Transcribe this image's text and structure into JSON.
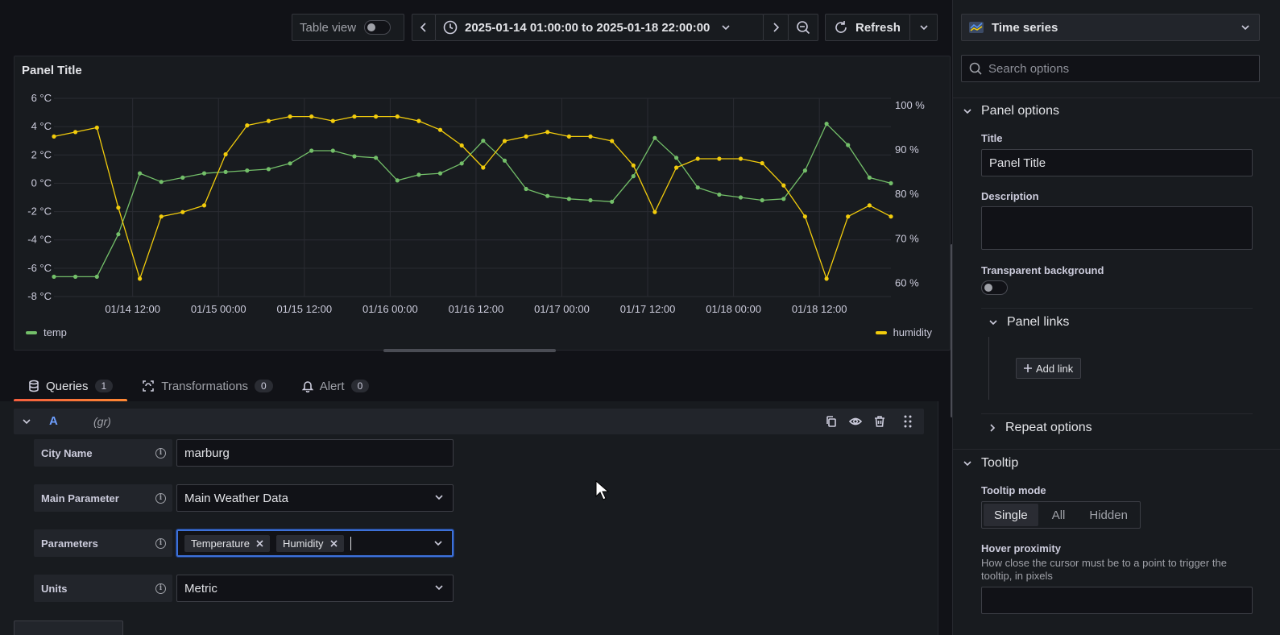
{
  "toolbar": {
    "table_view_label": "Table view",
    "time_range": "2025-01-14 01:00:00 to 2025-01-18 22:00:00",
    "refresh_label": "Refresh"
  },
  "panel": {
    "title": "Panel Title"
  },
  "chart_data": {
    "type": "line",
    "title": "Panel Title",
    "x_ticks": [
      "01/14 12:00",
      "01/15 00:00",
      "01/15 12:00",
      "01/16 00:00",
      "01/16 12:00",
      "01/17 00:00",
      "01/17 12:00",
      "01/18 00:00",
      "01/18 12:00"
    ],
    "y_left_ticks": [
      "6 °C",
      "4 °C",
      "2 °C",
      "0 °C",
      "-2 °C",
      "-4 °C",
      "-6 °C",
      "-8 °C"
    ],
    "y_right_ticks": [
      "100 %",
      "90 %",
      "80 %",
      "70 %",
      "60 %"
    ],
    "y_left_range": [
      -8,
      6
    ],
    "y_right_range": [
      57.0,
      101.6
    ],
    "x_range": [
      "2025-01-14 01:00",
      "2025-01-18 22:00"
    ],
    "grid": true,
    "legend": [
      "bottom-left",
      "bottom-right"
    ],
    "series": [
      {
        "name": "temp",
        "axis": "left",
        "color": "#73bf69",
        "points": [
          [
            "2025-01-14 01:00",
            -6.6
          ],
          [
            "2025-01-14 04:00",
            -6.6
          ],
          [
            "2025-01-14 07:00",
            -6.6
          ],
          [
            "2025-01-14 10:00",
            -3.6
          ],
          [
            "2025-01-14 13:00",
            0.7
          ],
          [
            "2025-01-14 16:00",
            0.1
          ],
          [
            "2025-01-14 19:00",
            0.4
          ],
          [
            "2025-01-14 22:00",
            0.7
          ],
          [
            "2025-01-15 01:00",
            0.8
          ],
          [
            "2025-01-15 04:00",
            0.9
          ],
          [
            "2025-01-15 07:00",
            1.0
          ],
          [
            "2025-01-15 10:00",
            1.4
          ],
          [
            "2025-01-15 13:00",
            2.3
          ],
          [
            "2025-01-15 16:00",
            2.3
          ],
          [
            "2025-01-15 19:00",
            1.9
          ],
          [
            "2025-01-15 22:00",
            1.8
          ],
          [
            "2025-01-16 01:00",
            0.2
          ],
          [
            "2025-01-16 04:00",
            0.6
          ],
          [
            "2025-01-16 07:00",
            0.7
          ],
          [
            "2025-01-16 10:00",
            1.4
          ],
          [
            "2025-01-16 13:00",
            3.0
          ],
          [
            "2025-01-16 16:00",
            1.6
          ],
          [
            "2025-01-16 19:00",
            -0.4
          ],
          [
            "2025-01-16 22:00",
            -0.9
          ],
          [
            "2025-01-17 01:00",
            -1.1
          ],
          [
            "2025-01-17 04:00",
            -1.2
          ],
          [
            "2025-01-17 07:00",
            -1.3
          ],
          [
            "2025-01-17 10:00",
            0.5
          ],
          [
            "2025-01-17 13:00",
            3.2
          ],
          [
            "2025-01-17 16:00",
            1.8
          ],
          [
            "2025-01-17 19:00",
            -0.3
          ],
          [
            "2025-01-17 22:00",
            -0.8
          ],
          [
            "2025-01-18 01:00",
            -1.0
          ],
          [
            "2025-01-18 04:00",
            -1.2
          ],
          [
            "2025-01-18 07:00",
            -1.1
          ],
          [
            "2025-01-18 10:00",
            0.9
          ],
          [
            "2025-01-18 13:00",
            4.2
          ],
          [
            "2025-01-18 16:00",
            2.7
          ],
          [
            "2025-01-18 19:00",
            0.4
          ],
          [
            "2025-01-18 22:00",
            0.0
          ]
        ]
      },
      {
        "name": "humidity",
        "axis": "right",
        "color": "#f2cc0c",
        "points": [
          [
            "2025-01-14 01:00",
            93
          ],
          [
            "2025-01-14 04:00",
            94
          ],
          [
            "2025-01-14 07:00",
            95
          ],
          [
            "2025-01-14 10:00",
            77
          ],
          [
            "2025-01-14 13:00",
            61
          ],
          [
            "2025-01-14 16:00",
            75
          ],
          [
            "2025-01-14 19:00",
            76
          ],
          [
            "2025-01-14 22:00",
            77.5
          ],
          [
            "2025-01-15 01:00",
            89
          ],
          [
            "2025-01-15 04:00",
            95.5
          ],
          [
            "2025-01-15 07:00",
            96.5
          ],
          [
            "2025-01-15 10:00",
            97.5
          ],
          [
            "2025-01-15 13:00",
            97.5
          ],
          [
            "2025-01-15 16:00",
            96.5
          ],
          [
            "2025-01-15 19:00",
            97.5
          ],
          [
            "2025-01-15 22:00",
            97.5
          ],
          [
            "2025-01-16 01:00",
            97.5
          ],
          [
            "2025-01-16 04:00",
            96.5
          ],
          [
            "2025-01-16 07:00",
            94.5
          ],
          [
            "2025-01-16 10:00",
            91
          ],
          [
            "2025-01-16 13:00",
            86
          ],
          [
            "2025-01-16 16:00",
            92
          ],
          [
            "2025-01-16 19:00",
            93
          ],
          [
            "2025-01-16 22:00",
            94
          ],
          [
            "2025-01-17 01:00",
            93
          ],
          [
            "2025-01-17 04:00",
            93
          ],
          [
            "2025-01-17 07:00",
            92
          ],
          [
            "2025-01-17 10:00",
            86.5
          ],
          [
            "2025-01-17 13:00",
            76
          ],
          [
            "2025-01-17 16:00",
            86
          ],
          [
            "2025-01-17 19:00",
            88
          ],
          [
            "2025-01-17 22:00",
            88
          ],
          [
            "2025-01-18 01:00",
            88
          ],
          [
            "2025-01-18 04:00",
            87
          ],
          [
            "2025-01-18 07:00",
            82
          ],
          [
            "2025-01-18 10:00",
            75
          ],
          [
            "2025-01-18 13:00",
            61
          ],
          [
            "2025-01-18 16:00",
            75
          ],
          [
            "2025-01-18 19:00",
            77.5
          ],
          [
            "2025-01-18 22:00",
            75
          ]
        ]
      }
    ]
  },
  "tabs": [
    {
      "label": "Queries",
      "count": "1"
    },
    {
      "label": "Transformations",
      "count": "0"
    },
    {
      "label": "Alert",
      "count": "0"
    }
  ],
  "query": {
    "ref_id": "A",
    "datasource": "(gr)",
    "fields": {
      "city_label": "City Name",
      "city_value": "marburg",
      "main_param_label": "Main Parameter",
      "main_param_value": "Main Weather Data",
      "params_label": "Parameters",
      "params_chips": [
        "Temperature",
        "Humidity"
      ],
      "units_label": "Units",
      "units_value": "Metric"
    }
  },
  "sidebar": {
    "viz_type": "Time series",
    "search_placeholder": "Search options",
    "panel_options_title": "Panel options",
    "title_label": "Title",
    "title_value": "Panel Title",
    "description_label": "Description",
    "transparent_label": "Transparent background",
    "panel_links_title": "Panel links",
    "add_link_label": "Add link",
    "repeat_options_title": "Repeat options",
    "tooltip_title": "Tooltip",
    "tooltip_mode_label": "Tooltip mode",
    "tooltip_modes": [
      "Single",
      "All",
      "Hidden"
    ],
    "tooltip_mode_selected": "Single",
    "hover_label": "Hover proximity",
    "hover_desc": "How close the cursor must be to a point to trigger the tooltip, in pixels"
  }
}
